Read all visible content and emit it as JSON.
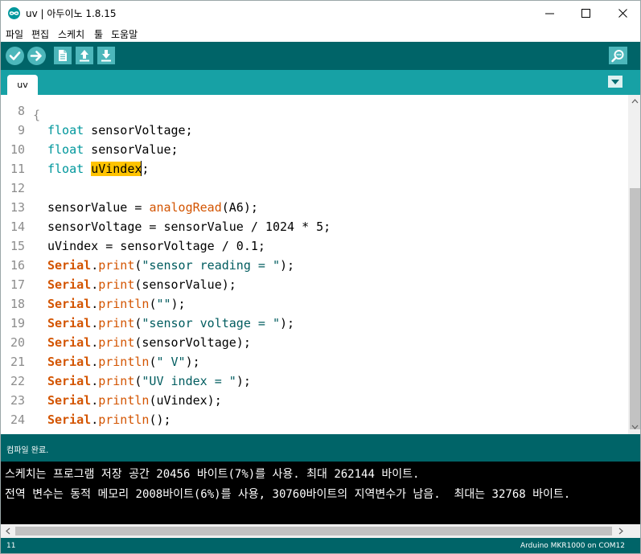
{
  "window": {
    "title": "uv | 아두이노 1.8.15",
    "icons": {
      "app": "arduino-logo-icon",
      "minimize": "minimize-icon",
      "maximize": "maximize-icon",
      "close": "close-icon"
    }
  },
  "menu": [
    "파일",
    "편집",
    "스케치",
    "툴",
    "도움말"
  ],
  "toolbar": {
    "buttons": [
      "verify-icon",
      "upload-icon",
      "new-sketch-icon",
      "open-sketch-icon",
      "save-sketch-icon"
    ],
    "serial_monitor": "serial-monitor-icon"
  },
  "tabs": [
    {
      "label": "uv",
      "active": true
    }
  ],
  "editor": {
    "lines": [
      {
        "num": "8",
        "tokens": []
      },
      {
        "num": "9",
        "tokens": [
          {
            "t": "float",
            "c": "kw"
          },
          {
            "t": " sensorVoltage;",
            "c": "plain"
          }
        ]
      },
      {
        "num": "10",
        "tokens": [
          {
            "t": "float",
            "c": "kw"
          },
          {
            "t": " sensorValue;",
            "c": "plain"
          }
        ]
      },
      {
        "num": "11",
        "tokens": [
          {
            "t": "float",
            "c": "kw"
          },
          {
            "t": " ",
            "c": "plain"
          },
          {
            "t": "uVindex",
            "c": "hl"
          },
          {
            "t": "",
            "c": "caret"
          },
          {
            "t": ";",
            "c": "plain"
          }
        ]
      },
      {
        "num": "12",
        "tokens": []
      },
      {
        "num": "13",
        "tokens": [
          {
            "t": "sensorValue = ",
            "c": "plain"
          },
          {
            "t": "analogRead",
            "c": "fn"
          },
          {
            "t": "(A6);",
            "c": "plain"
          }
        ]
      },
      {
        "num": "14",
        "tokens": [
          {
            "t": "sensorVoltage = sensorValue / 1024 * 5;",
            "c": "plain"
          }
        ]
      },
      {
        "num": "15",
        "tokens": [
          {
            "t": "uVindex = sensorVoltage / 0.1;",
            "c": "plain"
          }
        ]
      },
      {
        "num": "16",
        "tokens": [
          {
            "t": "Serial",
            "c": "obj"
          },
          {
            "t": ".",
            "c": "plain"
          },
          {
            "t": "print",
            "c": "fn"
          },
          {
            "t": "(",
            "c": "plain"
          },
          {
            "t": "\"sensor reading = \"",
            "c": "str"
          },
          {
            "t": ");",
            "c": "plain"
          }
        ]
      },
      {
        "num": "17",
        "tokens": [
          {
            "t": "Serial",
            "c": "obj"
          },
          {
            "t": ".",
            "c": "plain"
          },
          {
            "t": "print",
            "c": "fn"
          },
          {
            "t": "(sensorValue);",
            "c": "plain"
          }
        ]
      },
      {
        "num": "18",
        "tokens": [
          {
            "t": "Serial",
            "c": "obj"
          },
          {
            "t": ".",
            "c": "plain"
          },
          {
            "t": "println",
            "c": "fn"
          },
          {
            "t": "(",
            "c": "plain"
          },
          {
            "t": "\"\"",
            "c": "str"
          },
          {
            "t": ");",
            "c": "plain"
          }
        ]
      },
      {
        "num": "19",
        "tokens": [
          {
            "t": "Serial",
            "c": "obj"
          },
          {
            "t": ".",
            "c": "plain"
          },
          {
            "t": "print",
            "c": "fn"
          },
          {
            "t": "(",
            "c": "plain"
          },
          {
            "t": "\"sensor voltage = \"",
            "c": "str"
          },
          {
            "t": ");",
            "c": "plain"
          }
        ]
      },
      {
        "num": "20",
        "tokens": [
          {
            "t": "Serial",
            "c": "obj"
          },
          {
            "t": ".",
            "c": "plain"
          },
          {
            "t": "print",
            "c": "fn"
          },
          {
            "t": "(sensorVoltage);",
            "c": "plain"
          }
        ]
      },
      {
        "num": "21",
        "tokens": [
          {
            "t": "Serial",
            "c": "obj"
          },
          {
            "t": ".",
            "c": "plain"
          },
          {
            "t": "println",
            "c": "fn"
          },
          {
            "t": "(",
            "c": "plain"
          },
          {
            "t": "\" V\"",
            "c": "str"
          },
          {
            "t": ");",
            "c": "plain"
          }
        ]
      },
      {
        "num": "22",
        "tokens": [
          {
            "t": "Serial",
            "c": "obj"
          },
          {
            "t": ".",
            "c": "plain"
          },
          {
            "t": "print",
            "c": "fn"
          },
          {
            "t": "(",
            "c": "plain"
          },
          {
            "t": "\"UV index = \"",
            "c": "str"
          },
          {
            "t": ");",
            "c": "plain"
          }
        ]
      },
      {
        "num": "23",
        "tokens": [
          {
            "t": "Serial",
            "c": "obj"
          },
          {
            "t": ".",
            "c": "plain"
          },
          {
            "t": "println",
            "c": "fn"
          },
          {
            "t": "(uVindex);",
            "c": "plain"
          }
        ]
      },
      {
        "num": "24",
        "tokens": [
          {
            "t": "Serial",
            "c": "obj"
          },
          {
            "t": ".",
            "c": "plain"
          },
          {
            "t": "println",
            "c": "fn"
          },
          {
            "t": "();",
            "c": "plain"
          }
        ]
      }
    ]
  },
  "status": {
    "message": "컴파일 완료."
  },
  "console": {
    "lines": [
      "스케치는 프로그램 저장 공간 20456 바이트(7%)를 사용. 최대 262144 바이트.",
      "전역 변수는 동적 메모리 2008바이트(6%)를 사용, 30760바이트의 지역변수가 남음.  최대는 32768 바이트."
    ]
  },
  "bottom": {
    "line": "11",
    "board": "Arduino MKR1000 on COM12"
  },
  "colors": {
    "teal_dark": "#006468",
    "teal_tab": "#17a1a5",
    "button": "#4db7bb",
    "keyword": "#00979c",
    "function": "#d35400",
    "string": "#005c5f",
    "highlight": "#ffc300"
  }
}
